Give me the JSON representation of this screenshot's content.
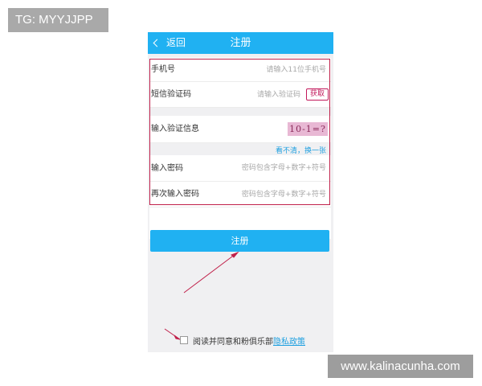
{
  "overlay": {
    "tg_label": "TG: MYYJJPP",
    "site_label": "www.kalinacunha.com"
  },
  "header": {
    "back_label": "返回",
    "title": "注册"
  },
  "form": {
    "phone": {
      "label": "手机号",
      "placeholder": "请输入11位手机号"
    },
    "sms": {
      "label": "短信验证码",
      "placeholder": "请输入验证码",
      "get_code": "获取"
    },
    "captcha": {
      "label": "输入验证信息",
      "image_text": "10-1=?",
      "refresh": "看不清，换一张"
    },
    "password": {
      "label": "输入密码",
      "placeholder": "密码包含字母+数字+符号"
    },
    "confirm": {
      "label": "再次输入密码",
      "placeholder": "密码包含字母+数字+符号"
    }
  },
  "register_button": "注册",
  "agreement": {
    "text": "阅读并同意和粉俱乐部",
    "policy": "隐私政策"
  },
  "colors": {
    "accent": "#20b1f2",
    "annotation": "#c0204a"
  }
}
